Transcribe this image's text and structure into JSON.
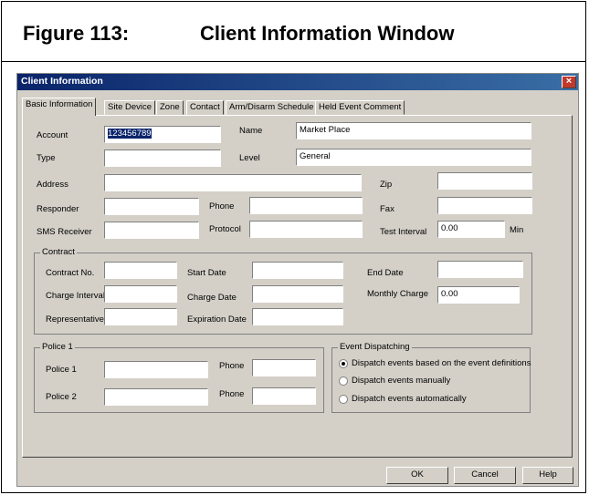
{
  "figure": {
    "number": "Figure 113:",
    "title": "Client Information Window"
  },
  "window": {
    "title": "Client Information",
    "close_glyph": "×"
  },
  "tabs": [
    {
      "label": "Basic Information"
    },
    {
      "label": "Site Device"
    },
    {
      "label": "Zone"
    },
    {
      "label": "Contact"
    },
    {
      "label": "Arm/Disarm Schedule"
    },
    {
      "label": "Held Event Comment"
    }
  ],
  "basic": {
    "account": {
      "label": "Account",
      "value": "123456789"
    },
    "name": {
      "label": "Name",
      "value": "Market Place"
    },
    "type": {
      "label": "Type",
      "value": ""
    },
    "level": {
      "label": "Level",
      "value": "General"
    },
    "address": {
      "label": "Address",
      "value": ""
    },
    "zip": {
      "label": "Zip",
      "value": ""
    },
    "responder": {
      "label": "Responder",
      "value": ""
    },
    "phone": {
      "label": "Phone",
      "value": ""
    },
    "fax": {
      "label": "Fax",
      "value": ""
    },
    "sms_receiver": {
      "label": "SMS Receiver",
      "value": ""
    },
    "protocol": {
      "label": "Protocol",
      "value": ""
    },
    "test_interval": {
      "label": "Test Interval",
      "value": "0.00",
      "unit": "Min"
    }
  },
  "contract": {
    "group_label": "Contract",
    "contract_no": {
      "label": "Contract No.",
      "value": ""
    },
    "start_date": {
      "label": "Start Date",
      "value": ""
    },
    "end_date": {
      "label": "End Date",
      "value": ""
    },
    "charge_interval": {
      "label": "Charge Interval",
      "value": ""
    },
    "charge_date": {
      "label": "Charge Date",
      "value": ""
    },
    "monthly_charge": {
      "label": "Monthly Charge",
      "value": "0.00"
    },
    "representative": {
      "label": "Representative",
      "value": ""
    },
    "expiration_date": {
      "label": "Expiration Date",
      "value": ""
    }
  },
  "police": {
    "group_label": "Police 1",
    "police1": {
      "label": "Police 1",
      "value": ""
    },
    "phone1": {
      "label": "Phone",
      "value": ""
    },
    "police2": {
      "label": "Police 2",
      "value": ""
    },
    "phone2": {
      "label": "Phone",
      "value": ""
    }
  },
  "dispatching": {
    "group_label": "Event Dispatching",
    "options": [
      {
        "label": "Dispatch events based on the event definitions",
        "selected": true
      },
      {
        "label": "Dispatch events manually",
        "selected": false
      },
      {
        "label": "Dispatch events automatically",
        "selected": false
      }
    ]
  },
  "buttons": {
    "ok": "OK",
    "cancel": "Cancel",
    "help": "Help"
  },
  "colors": {
    "titlebar_start": "#0a246a",
    "titlebar_end": "#3a6ea5",
    "dialog_bg": "#d4d0c8",
    "close_icon": "#c0392b"
  }
}
